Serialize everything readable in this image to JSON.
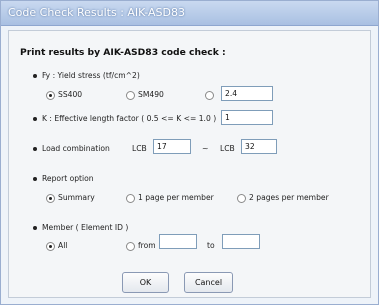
{
  "window": {
    "title": "Code Check Results : AIK-ASD83"
  },
  "heading": "Print results by AIK-ASD83 code check :",
  "fy": {
    "label": "Fy : Yield stress  (tf/cm^2)",
    "options": [
      "SS400",
      "SM490",
      ""
    ],
    "selected_index": 0,
    "custom_value": "2.4"
  },
  "k": {
    "label": "K : Effective length factor  ( 0.5 <= K <= 1.0 )",
    "value": "1"
  },
  "load": {
    "label": "Load combination",
    "from_label": "LCB",
    "from_value": "17",
    "separator": "~",
    "to_label": "LCB",
    "to_value": "32"
  },
  "report": {
    "label": "Report option",
    "options": [
      "Summary",
      "1 page per member",
      "2 pages per member"
    ],
    "selected_index": 0
  },
  "member": {
    "label": "Member ( Element ID )",
    "options": [
      "All",
      "from"
    ],
    "selected_index": 0,
    "to_label": "to",
    "from_value": "",
    "to_value": ""
  },
  "buttons": {
    "ok": "OK",
    "cancel": "Cancel"
  }
}
